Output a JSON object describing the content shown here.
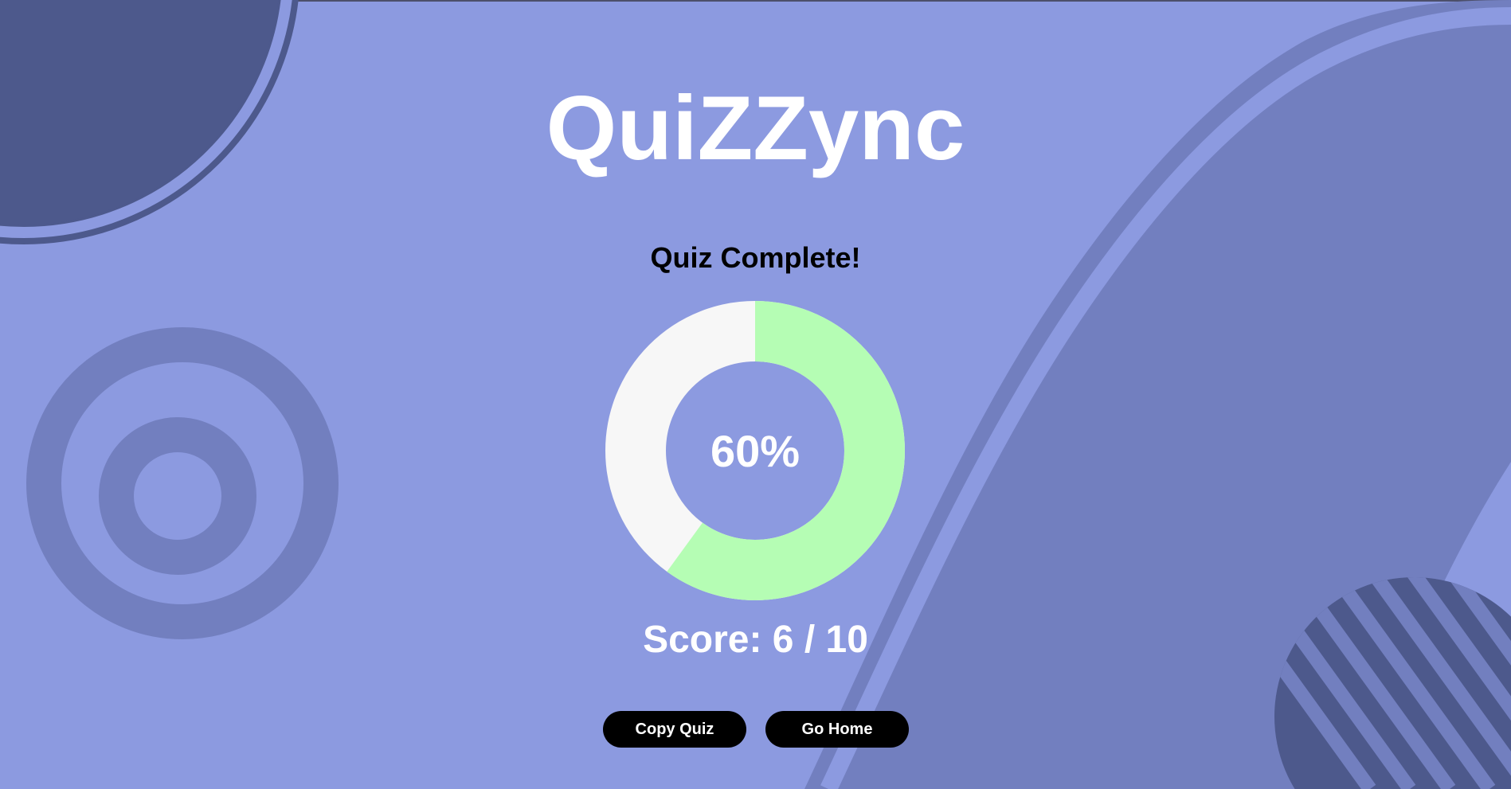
{
  "app": {
    "title": "QuiZZync"
  },
  "result": {
    "heading": "Quiz Complete!",
    "percent_label": "60%",
    "percent_value": 0.6,
    "score_label": "Score: 6 / 10",
    "colors": {
      "correct": "#b5fdb4",
      "remaining": "#f7f7f7"
    }
  },
  "actions": {
    "copy_label": "Copy Quiz",
    "home_label": "Go Home"
  },
  "theme": {
    "background": "#8c9ae0",
    "dark_shape": "#4d598c",
    "mid_shape": "#727fbf"
  }
}
